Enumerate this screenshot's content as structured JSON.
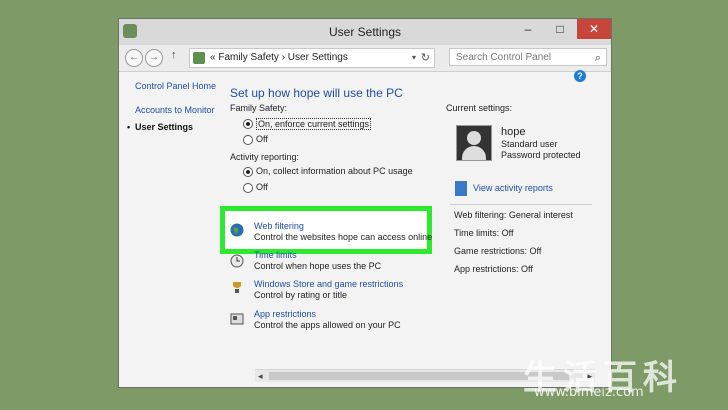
{
  "window": {
    "title": "User Settings",
    "minimize": "–",
    "maximize": "□",
    "close": "✕"
  },
  "address": {
    "back": "←",
    "forward": "→",
    "up": "↑",
    "path": "« Family Safety  ›  User Settings",
    "dropdown": "▾",
    "refresh": "↻"
  },
  "search": {
    "placeholder": "Search Control Panel",
    "icon": "⌕"
  },
  "help_label": "?",
  "sidebar": {
    "items": [
      {
        "label": "Control Panel Home",
        "current": false
      },
      {
        "label": "Accounts to Monitor",
        "current": false
      },
      {
        "label": "User Settings",
        "current": true
      }
    ],
    "bullet": "•"
  },
  "main": {
    "heading": "Set up how hope will use the PC",
    "family_safety": {
      "label": "Family Safety:",
      "options": [
        {
          "label": "On, enforce current settings",
          "selected": true
        },
        {
          "label": "Off",
          "selected": false
        }
      ]
    },
    "activity_reporting": {
      "label": "Activity reporting:",
      "options": [
        {
          "label": "On, collect information about PC usage",
          "selected": true
        },
        {
          "label": "Off",
          "selected": false
        }
      ]
    },
    "settings": [
      {
        "title": "Web filtering",
        "desc": "Control the websites hope can access online",
        "icon": "globe-icon"
      },
      {
        "title": "Time limits",
        "desc": "Control when hope uses the PC",
        "icon": "clock-icon"
      },
      {
        "title": "Windows Store and game restrictions",
        "desc": "Control by rating or title",
        "icon": "trophy-icon"
      },
      {
        "title": "App restrictions",
        "desc": "Control the apps allowed on your PC",
        "icon": "app-icon"
      }
    ]
  },
  "current": {
    "label": "Current settings:",
    "user": {
      "name": "hope",
      "type": "Standard user",
      "password": "Password protected"
    },
    "view_reports": "View activity reports",
    "summary": [
      "Web filtering: General interest",
      "Time limits: Off",
      "Game restrictions: Off",
      "App restrictions: Off"
    ]
  },
  "scrollbar": {
    "left": "◂",
    "right": "▸"
  },
  "watermark": {
    "text": "生活百科",
    "url": "www.bimeiz.com"
  },
  "colors": {
    "background": "#7d9a67",
    "link": "#1e4e9f",
    "highlight": "#2eea2e",
    "close": "#c7463a"
  }
}
